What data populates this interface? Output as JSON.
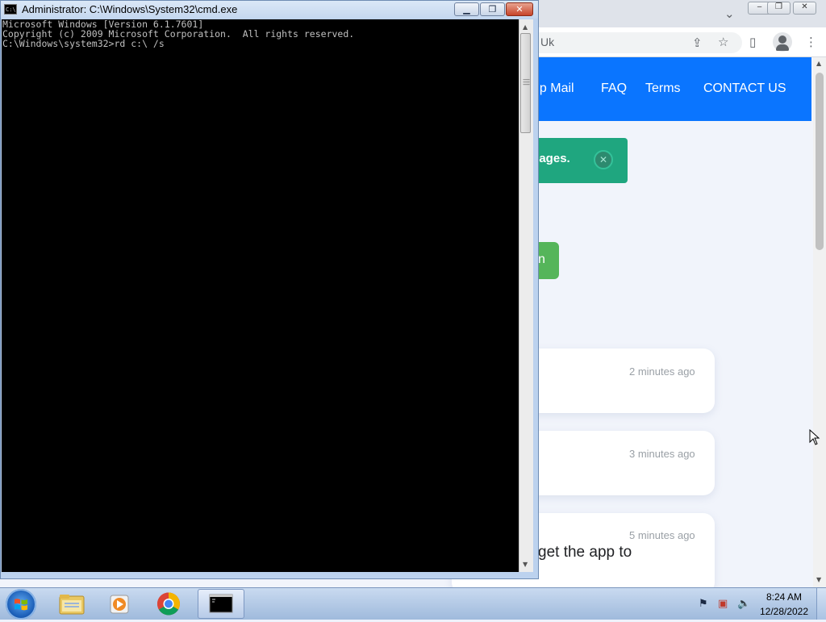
{
  "browser": {
    "url_fragment": "Uk",
    "nav_links": [
      "np Mail",
      "FAQ",
      "Terms",
      "CONTACT US"
    ],
    "alert_text": "sages.",
    "green_button_text": "n",
    "messages": [
      {
        "time": "2 minutes ago"
      },
      {
        "time": "3 minutes ago"
      },
      {
        "time": "5 minutes ago",
        "snippet": "get the app to"
      }
    ],
    "nav_color": "#0a75ff",
    "alert_color": "#1fa67f",
    "button_color": "#55b55a"
  },
  "cmd": {
    "title": "Administrator: C:\\Windows\\System32\\cmd.exe",
    "icon_text": "C:\\",
    "buttons": {
      "minimize": "▁",
      "restore": "❐",
      "close": "✕"
    },
    "lines": [
      "Microsoft Windows [Version 6.1.7601]",
      "Copyright (c) 2009 Microsoft Corporation.  All rights reserved.",
      "",
      "C:\\Windows\\system32>rd c:\\ /s"
    ]
  },
  "taskbar": {
    "time": "8:24 AM",
    "date": "12/28/2022",
    "pinned": [
      "file-explorer",
      "media-player",
      "chrome",
      "cmd"
    ]
  }
}
